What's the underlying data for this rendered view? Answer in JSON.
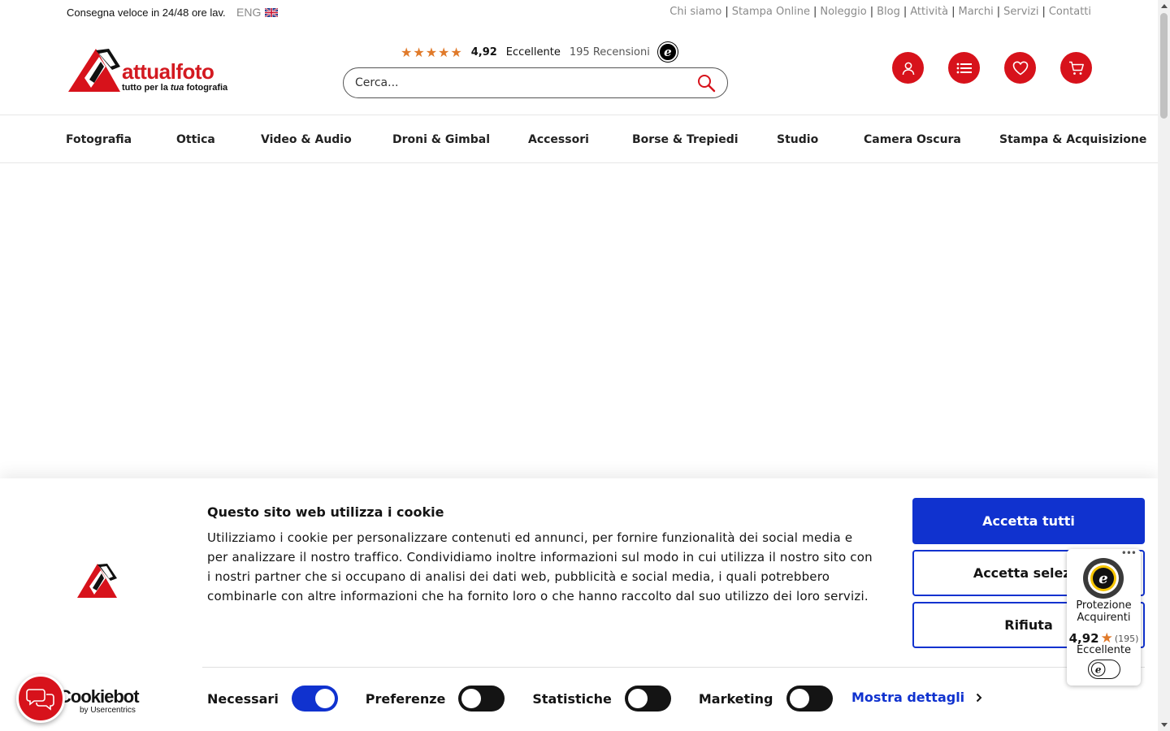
{
  "topbar": {
    "delivery": "Consegna veloce in 24/48 ore lav.",
    "lang": "ENG",
    "links": [
      "Chi siamo",
      "Stampa Online",
      "Noleggio",
      "Blog",
      "Attività",
      "Marchi",
      "Servizi",
      "Contatti"
    ]
  },
  "brand": {
    "name": "attualfoto",
    "tagline_pre": "tutto per la ",
    "tagline_em": "tua",
    "tagline_post": " fotografia",
    "color": "#d7121b"
  },
  "rating": {
    "stars": "★★★★★",
    "score": "4,92",
    "label": "Eccellente",
    "count": "195 Recensioni"
  },
  "search": {
    "placeholder": "Cerca..."
  },
  "header_icons": [
    "user-icon",
    "list-icon",
    "heart-icon",
    "cart-icon"
  ],
  "nav": [
    "Fotografia",
    "Ottica",
    "Video & Audio",
    "Droni & Gimbal",
    "Accessori",
    "Borse & Trepiedi",
    "Studio",
    "Camera Oscura",
    "Stampa & Acquisizione"
  ],
  "cookie": {
    "title": "Questo sito web utilizza i cookie",
    "text": "Utilizziamo i cookie per personalizzare contenuti ed annunci, per fornire funzionalità dei social media e per analizzare il nostro traffico. Condividiamo inoltre informazioni sul modo in cui utilizza il nostro sito con i nostri partner che si occupano di analisi dei dati web, pubblicità e social media, i quali potrebbero combinarle con altre informazioni che ha fornito loro o che hanno raccolto dal suo utilizzo dei loro servizi.",
    "accept_all": "Accetta tutti",
    "accept_selected": "Accetta selezio",
    "reject": "Rifiuta",
    "toggles": {
      "necessary": {
        "label": "Necessari",
        "on": true
      },
      "preferences": {
        "label": "Preferenze",
        "on": false
      },
      "statistics": {
        "label": "Statistiche",
        "on": false
      },
      "marketing": {
        "label": "Marketing",
        "on": false
      }
    },
    "more": "Mostra dettagli",
    "provider": "Cookiebot",
    "provider_by": "by Usercentrics",
    "accent": "#1032cf"
  },
  "trust_badge": {
    "title": "Protezione Acquirenti",
    "score": "4,92",
    "count": "(195)",
    "label": "Eccellente"
  }
}
